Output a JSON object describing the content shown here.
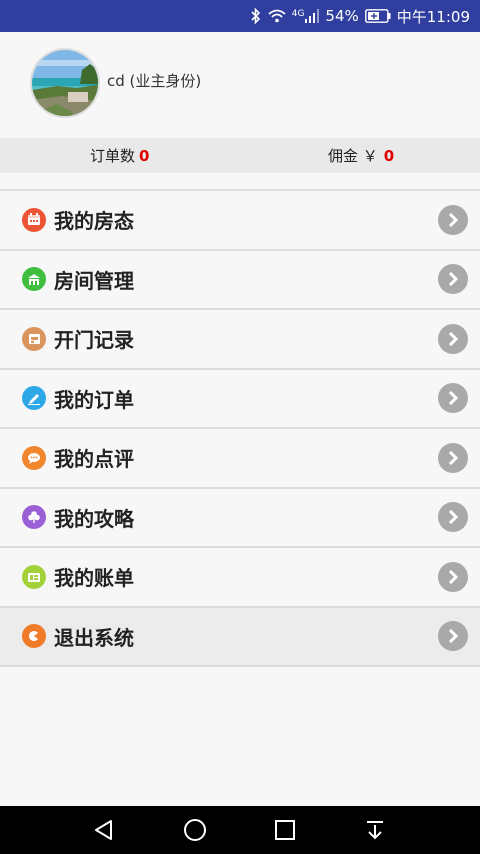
{
  "status_bar": {
    "network": "4G",
    "battery": "54%",
    "time": "中午11:09",
    "colors": {
      "background": "#303f9f"
    }
  },
  "profile": {
    "username": "cd (业主身份)"
  },
  "stats": {
    "orders_label": "订单数",
    "orders_value": "0",
    "commission_label": "佣金 ￥",
    "commission_value": "0"
  },
  "menu": {
    "items": [
      {
        "label": "我的房态",
        "icon": "calendar-icon",
        "color": "#ec5436"
      },
      {
        "label": "房间管理",
        "icon": "home-icon",
        "color": "#3fbe3f"
      },
      {
        "label": "开门记录",
        "icon": "door-icon",
        "color": "#d9955c"
      },
      {
        "label": "我的订单",
        "icon": "pen-icon",
        "color": "#2ea8e6"
      },
      {
        "label": "我的点评",
        "icon": "comment-icon",
        "color": "#f0862d"
      },
      {
        "label": "我的攻略",
        "icon": "clover-icon",
        "color": "#9b5fd6"
      },
      {
        "label": "我的账单",
        "icon": "bill-icon",
        "color": "#a3d13a"
      },
      {
        "label": "退出系统",
        "icon": "logout-icon",
        "color": "#f07c2a"
      }
    ]
  },
  "navbar": {
    "buttons": [
      "back-icon",
      "home-circle-icon",
      "recents-icon",
      "menu-down-icon"
    ]
  }
}
